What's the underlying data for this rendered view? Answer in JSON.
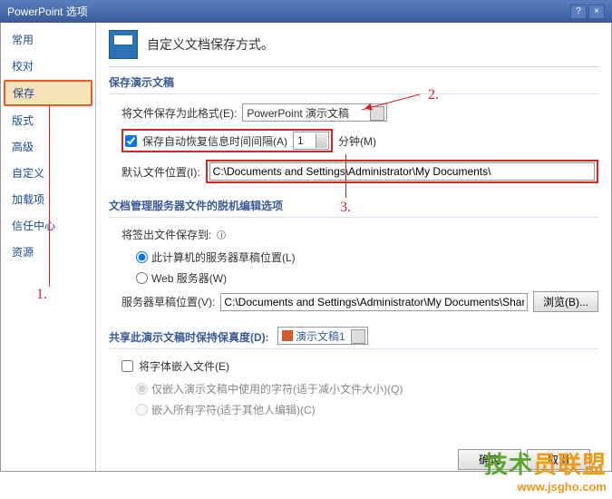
{
  "title": "PowerPoint 选项",
  "sidebar": {
    "items": [
      {
        "label": "常用"
      },
      {
        "label": "校对"
      },
      {
        "label": "保存"
      },
      {
        "label": "版式"
      },
      {
        "label": "高级"
      },
      {
        "label": "自定义"
      },
      {
        "label": "加载项"
      },
      {
        "label": "信任中心"
      },
      {
        "label": "资源"
      }
    ],
    "selected_index": 2
  },
  "header": {
    "text": "自定义文档保存方式。"
  },
  "section1": {
    "title": "保存演示文稿",
    "format_label": "将文件保存为此格式(E):",
    "format_value": "PowerPoint 演示文稿",
    "autosave_label": "保存自动恢复信息时间间隔(A)",
    "autosave_value": "1",
    "minutes_label": "分钟(M)",
    "default_loc_label": "默认文件位置(I):",
    "default_loc_value": "C:\\Documents and Settings\\Administrator\\My Documents\\"
  },
  "section2": {
    "title": "文档管理服务器文件的脱机编辑选项",
    "checkout_label": "将签出文件保存到:",
    "radio1": "此计算机的服务器草稿位置(L)",
    "radio2": "Web 服务器(W)",
    "server_loc_label": "服务器草稿位置(V):",
    "server_loc_value": "C:\\Documents and Settings\\Administrator\\My Documents\\SharePoint 草稿\\",
    "browse_btn": "浏览(B)..."
  },
  "section3": {
    "title": "共享此演示文稿时保持保真度(D):",
    "doc_value": "演示文稿1",
    "embed_label": "将字体嵌入文件(E)",
    "embed_opt1": "仅嵌入演示文稿中使用的字符(适于减小文件大小)(Q)",
    "embed_opt2": "嵌入所有字符(适于其他人编辑)(C)"
  },
  "annotations": {
    "a1": "1.",
    "a2": "2.",
    "a3": "3."
  },
  "footer": {
    "ok": "确定",
    "cancel": "取消"
  },
  "watermark": {
    "text": "技术员联盟",
    "url": "www.jsgho.com"
  }
}
